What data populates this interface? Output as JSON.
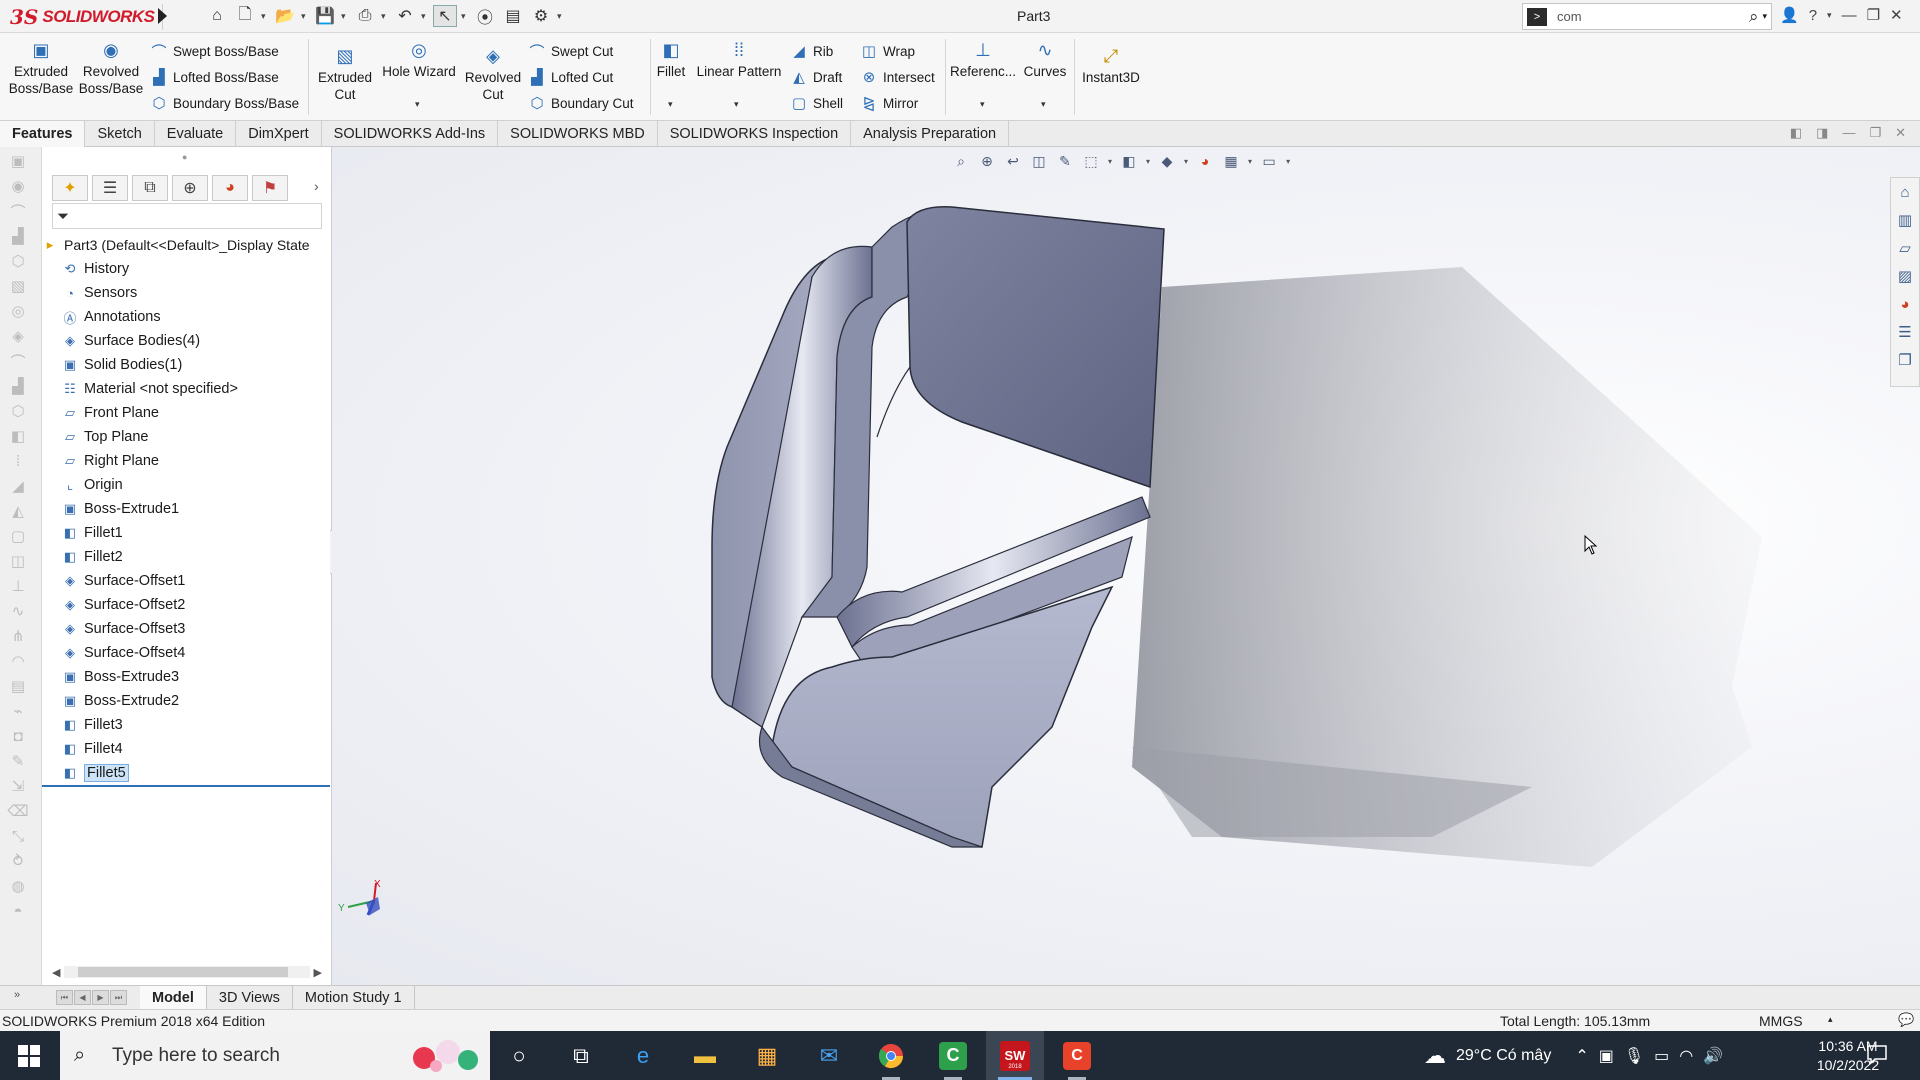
{
  "app": {
    "logo_ds": "3S",
    "logo_name": "SOLIDWORKS",
    "doc_title": "Part3",
    "search_value": "com",
    "search_cmd_glyph": ">"
  },
  "command_manager": {
    "extruded_boss": [
      "Extruded",
      "Boss/Base"
    ],
    "revolved_boss": [
      "Revolved",
      "Boss/Base"
    ],
    "swept_boss": "Swept Boss/Base",
    "lofted_boss": "Lofted Boss/Base",
    "boundary_boss": "Boundary Boss/Base",
    "extruded_cut": [
      "Extruded",
      "Cut"
    ],
    "hole_wizard": "Hole Wizard",
    "revolved_cut": [
      "Revolved",
      "Cut"
    ],
    "swept_cut": "Swept Cut",
    "lofted_cut": "Lofted Cut",
    "boundary_cut": "Boundary Cut",
    "fillet": "Fillet",
    "linear_pattern": "Linear Pattern",
    "rib": "Rib",
    "draft": "Draft",
    "shell": "Shell",
    "wrap": "Wrap",
    "intersect": "Intersect",
    "mirror": "Mirror",
    "reference": "Referenc...",
    "curves": "Curves",
    "instant3d": "Instant3D"
  },
  "tabs": [
    "Features",
    "Sketch",
    "Evaluate",
    "DimXpert",
    "SOLIDWORKS Add-Ins",
    "SOLIDWORKS MBD",
    "SOLIDWORKS Inspection",
    "Analysis Preparation"
  ],
  "feature_tree": {
    "root": "Part3  (Default<<Default>_Display State",
    "items": [
      {
        "label": "History",
        "icon": "history-icon"
      },
      {
        "label": "Sensors",
        "icon": "sensors-icon"
      },
      {
        "label": "Annotations",
        "icon": "annotations-icon"
      },
      {
        "label": "Surface Bodies(4)",
        "icon": "surface-bodies-icon"
      },
      {
        "label": "Solid Bodies(1)",
        "icon": "solid-bodies-icon"
      },
      {
        "label": "Material <not specified>",
        "icon": "material-icon"
      },
      {
        "label": "Front Plane",
        "icon": "plane-icon"
      },
      {
        "label": "Top Plane",
        "icon": "plane-icon"
      },
      {
        "label": "Right Plane",
        "icon": "plane-icon"
      },
      {
        "label": "Origin",
        "icon": "origin-icon"
      },
      {
        "label": "Boss-Extrude1",
        "icon": "extrude-icon"
      },
      {
        "label": "Fillet1",
        "icon": "fillet-icon"
      },
      {
        "label": "Fillet2",
        "icon": "fillet-icon"
      },
      {
        "label": "Surface-Offset1",
        "icon": "surface-offset-icon"
      },
      {
        "label": "Surface-Offset2",
        "icon": "surface-offset-icon"
      },
      {
        "label": "Surface-Offset3",
        "icon": "surface-offset-icon"
      },
      {
        "label": "Surface-Offset4",
        "icon": "surface-offset-icon"
      },
      {
        "label": "Boss-Extrude3",
        "icon": "extrude-icon"
      },
      {
        "label": "Boss-Extrude2",
        "icon": "extrude-icon"
      },
      {
        "label": "Fillet3",
        "icon": "fillet-icon"
      },
      {
        "label": "Fillet4",
        "icon": "fillet-icon"
      },
      {
        "label": "Fillet5",
        "icon": "fillet-icon",
        "selected": true
      }
    ]
  },
  "bottom_tabs": [
    "Model",
    "3D Views",
    "Motion Study 1"
  ],
  "status": {
    "edition": "SOLIDWORKS Premium 2018 x64 Edition",
    "total_length": "Total Length: 105.13mm",
    "units": "MMGS"
  },
  "triad": {
    "x": "X",
    "y": "Y"
  },
  "taskbar": {
    "search_placeholder": "Type here to search",
    "weather": "29°C  Có mây",
    "time": "10:36 AM",
    "date": "10/2/2022",
    "sw_badge": "SW",
    "sw_year": "2018"
  },
  "colors": {
    "brand_red": "#d11a2a",
    "accent_blue": "#2f6fb6",
    "selection": "#cde3f8",
    "taskbar": "#202a36"
  }
}
